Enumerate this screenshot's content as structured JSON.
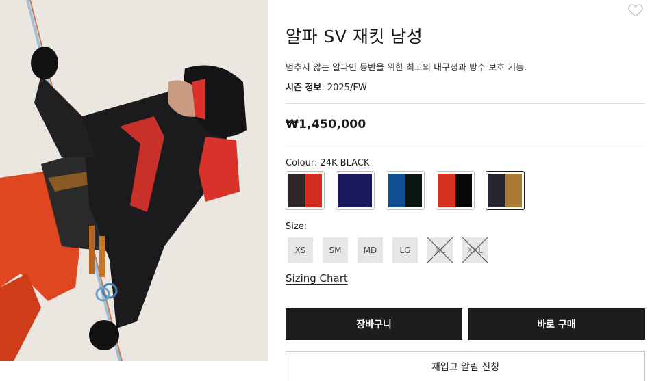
{
  "product": {
    "title": "알파 SV 재킷 남성",
    "description": "멈추지 않는 알파인 등반을 위한 최고의 내구성과 방수 보호 기능.",
    "season_label": "시즌 정보",
    "season_value": ": 2025/FW",
    "price": "₩1,450,000",
    "image": "climber-in-black-alpha-sv-jacket-photo"
  },
  "colour": {
    "label": "Colour: 24K BLACK",
    "swatches": [
      {
        "name": "brown-red",
        "left": "#2e2624",
        "right": "#d42c22",
        "selected": false
      },
      {
        "name": "navy",
        "left": "#1b1a5c",
        "right": "#1b1a5c",
        "selected": false
      },
      {
        "name": "blue-black",
        "left": "#0f4f92",
        "right": "#0c1512",
        "selected": false
      },
      {
        "name": "red-black",
        "left": "#d8301f",
        "right": "#080808",
        "selected": false
      },
      {
        "name": "24k-black",
        "left": "#25252d",
        "right": "#ac7b33",
        "selected": true
      }
    ]
  },
  "size": {
    "label": "Size:",
    "options": [
      {
        "label": "XS",
        "available": true
      },
      {
        "label": "SM",
        "available": true
      },
      {
        "label": "MD",
        "available": true
      },
      {
        "label": "LG",
        "available": true
      },
      {
        "label": "XL",
        "available": false
      },
      {
        "label": "XXL",
        "available": false
      }
    ]
  },
  "links": {
    "sizing_chart": "Sizing Chart"
  },
  "buttons": {
    "cart": "장바구니",
    "buy_now": "바로 구매",
    "restock_alert": "재입고 알림 신청"
  },
  "icons": {
    "wishlist": "heart-icon"
  }
}
